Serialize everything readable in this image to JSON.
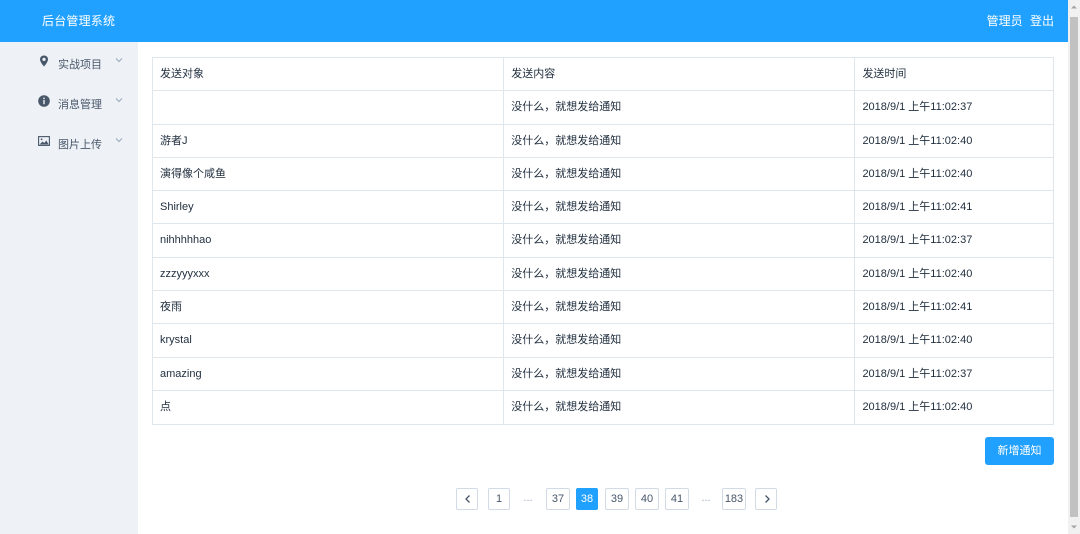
{
  "header": {
    "title": "后台管理系统",
    "user": "管理员",
    "logout": "登出"
  },
  "sidebar": {
    "items": [
      {
        "label": "实战项目",
        "icon": "location-icon"
      },
      {
        "label": "消息管理",
        "icon": "info-icon"
      },
      {
        "label": "图片上传",
        "icon": "picture-icon"
      }
    ]
  },
  "table": {
    "columns": [
      "发送对象",
      "发送内容",
      "发送时间"
    ],
    "rows": [
      [
        "",
        "没什么，就想发给通知",
        "2018/9/1 上午11:02:37"
      ],
      [
        "游者J",
        "没什么，就想发给通知",
        "2018/9/1 上午11:02:40"
      ],
      [
        "演得像个咸鱼",
        "没什么，就想发给通知",
        "2018/9/1 上午11:02:40"
      ],
      [
        "Shirley",
        "没什么，就想发给通知",
        "2018/9/1 上午11:02:41"
      ],
      [
        "nihhhhhao",
        "没什么，就想发给通知",
        "2018/9/1 上午11:02:37"
      ],
      [
        "zzzyyyxxx",
        "没什么，就想发给通知",
        "2018/9/1 上午11:02:40"
      ],
      [
        "夜雨",
        "没什么，就想发给通知",
        "2018/9/1 上午11:02:41"
      ],
      [
        "krystal",
        "没什么，就想发给通知",
        "2018/9/1 上午11:02:40"
      ],
      [
        "amazing",
        "没什么，就想发给通知",
        "2018/9/1 上午11:02:37"
      ],
      [
        "点",
        "没什么，就想发给通知",
        "2018/9/1 上午11:02:40"
      ]
    ]
  },
  "actions": {
    "add_label": "新增通知"
  },
  "pagination": {
    "pages": [
      "1",
      "...",
      "37",
      "38",
      "39",
      "40",
      "41",
      "...",
      "183"
    ],
    "current": "38"
  },
  "colors": {
    "primary": "#20a0ff",
    "sidebar_bg": "#eef1f6",
    "border": "#dfe6ec"
  }
}
